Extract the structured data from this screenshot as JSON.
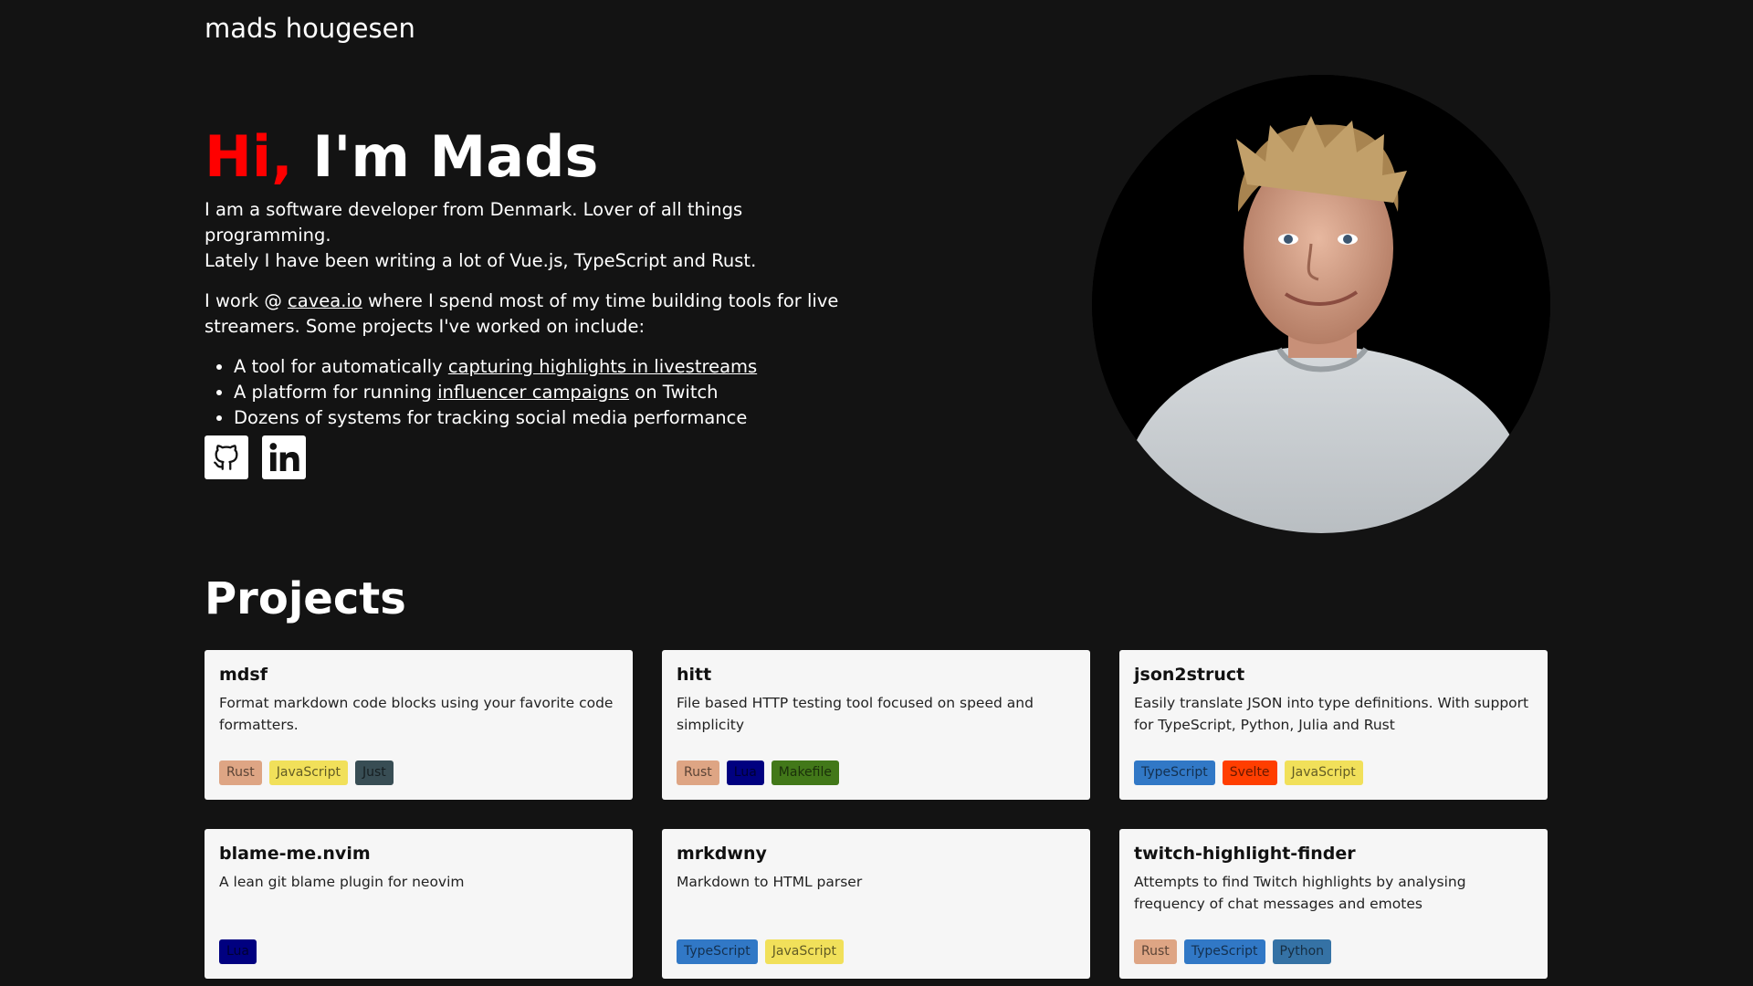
{
  "site": {
    "title": "mads hougesen"
  },
  "hero": {
    "greeting": "Hi,",
    "name": "I'm Mads",
    "intro_line1": "I am a software developer from Denmark. Lover of all things programming.",
    "intro_line2": "Lately I have been writing a lot of Vue.js, TypeScript and Rust.",
    "work_prefix": "I work @ ",
    "work_link": "cavea.io",
    "work_suffix": " where I spend most of my time building tools for live streamers. Some projects I've worked on include:",
    "bullets": [
      {
        "prefix": "A tool for automatically ",
        "link": "capturing highlights in livestreams",
        "suffix": ""
      },
      {
        "prefix": "A platform for running ",
        "link": "influencer campaigns",
        "suffix": " on Twitch"
      },
      {
        "prefix": "Dozens of systems for tracking social media performance",
        "link": "",
        "suffix": ""
      }
    ],
    "accent_color": "#ff0000"
  },
  "socials": [
    {
      "icon": "github-icon"
    },
    {
      "icon": "linkedin-icon"
    }
  ],
  "projects": {
    "heading": "Projects",
    "items": [
      {
        "name": "mdsf",
        "description": "Format markdown code blocks using your favorite code formatters.",
        "tags": [
          {
            "label": "Rust",
            "bg": "#dea584"
          },
          {
            "label": "JavaScript",
            "bg": "#f1e05a"
          },
          {
            "label": "Just",
            "bg": "#384d54"
          }
        ]
      },
      {
        "name": "hitt",
        "description": "File based HTTP testing tool focused on speed and simplicity",
        "tags": [
          {
            "label": "Rust",
            "bg": "#dea584"
          },
          {
            "label": "Lua",
            "bg": "#000080"
          },
          {
            "label": "Makefile",
            "bg": "#427819"
          }
        ]
      },
      {
        "name": "json2struct",
        "description": "Easily translate JSON into type definitions. With support for TypeScript, Python, Julia and Rust",
        "tags": [
          {
            "label": "TypeScript",
            "bg": "#3178c6"
          },
          {
            "label": "Svelte",
            "bg": "#ff3e00"
          },
          {
            "label": "JavaScript",
            "bg": "#f1e05a"
          }
        ]
      },
      {
        "name": "blame-me.nvim",
        "description": "A lean git blame plugin for neovim",
        "tags": [
          {
            "label": "Lua",
            "bg": "#000080"
          }
        ]
      },
      {
        "name": "mrkdwny",
        "description": "Markdown to HTML parser",
        "tags": [
          {
            "label": "TypeScript",
            "bg": "#3178c6"
          },
          {
            "label": "JavaScript",
            "bg": "#f1e05a"
          }
        ]
      },
      {
        "name": "twitch-highlight-finder",
        "description": "Attempts to find Twitch highlights by analysing frequency of chat messages and emotes",
        "tags": [
          {
            "label": "Rust",
            "bg": "#dea584"
          },
          {
            "label": "TypeScript",
            "bg": "#3178c6"
          },
          {
            "label": "Python",
            "bg": "#3572a5"
          }
        ]
      }
    ]
  }
}
